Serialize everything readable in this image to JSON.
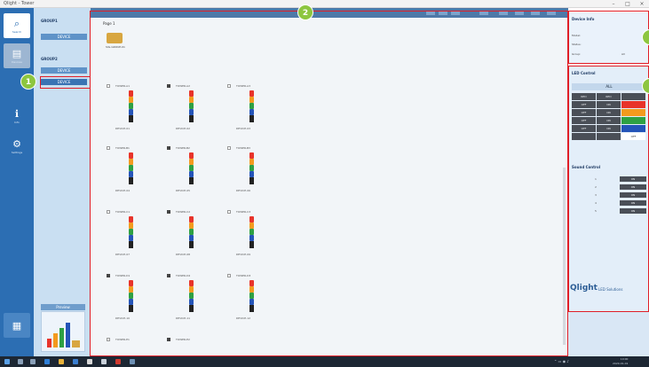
{
  "window": {
    "title": "Qlight - Tower",
    "controls": [
      "–",
      "□",
      "×"
    ]
  },
  "nav": [
    {
      "label": "Search",
      "icon": "magnifier-icon",
      "glyph": "⌕",
      "active": true
    },
    {
      "label": "Devices",
      "icon": "device-icon",
      "glyph": "▤",
      "active": false
    },
    {
      "label": "Info",
      "icon": "info-icon",
      "glyph": "ℹ",
      "active": false
    },
    {
      "label": "Settings",
      "icon": "settings-icon",
      "glyph": "⚙",
      "active": false
    }
  ],
  "tree": {
    "group_a": {
      "head": "GROUP1",
      "item": "DEVICE"
    },
    "group_b": {
      "head": "GROUP2",
      "item_1": "DEVICE",
      "item_2": "DEVICE"
    },
    "thumb_tag": "Preview"
  },
  "main": {
    "page_tab": "Page 1",
    "group_label": "SIG-GROUP-01",
    "towers": [
      {
        "name": "TOWER-A1",
        "cap": "DEVICE-01",
        "checked": false
      },
      {
        "name": "TOWER-A2",
        "cap": "DEVICE-02",
        "checked": true
      },
      {
        "name": "TOWER-A3",
        "cap": "DEVICE-03",
        "checked": false
      },
      {
        "name": "TOWER-B1",
        "cap": "DEVICE-04",
        "checked": false
      },
      {
        "name": "TOWER-B2",
        "cap": "DEVICE-05",
        "checked": true
      },
      {
        "name": "TOWER-B3",
        "cap": "DEVICE-06",
        "checked": false
      },
      {
        "name": "TOWER-C1",
        "cap": "DEVICE-07",
        "checked": false
      },
      {
        "name": "TOWER-C2",
        "cap": "DEVICE-08",
        "checked": true
      },
      {
        "name": "TOWER-C3",
        "cap": "DEVICE-09",
        "checked": false
      },
      {
        "name": "TOWER-D1",
        "cap": "DEVICE-10",
        "checked": true
      },
      {
        "name": "TOWER-D2",
        "cap": "DEVICE-11",
        "checked": true
      },
      {
        "name": "TOWER-D3",
        "cap": "DEVICE-12",
        "checked": false
      }
    ],
    "bottom_towers": [
      {
        "name": "TOWER-E1",
        "checked": false
      },
      {
        "name": "TOWER-E2",
        "checked": true
      }
    ]
  },
  "status_panel": {
    "title": "Device Info",
    "rows": [
      "Model:",
      "Status:",
      "Group:"
    ],
    "dropdown": "All"
  },
  "control_panel": {
    "title": "LED Control",
    "all_label": "ALL",
    "cells": [
      {
        "label": "RED",
        "color": "#4a4f57"
      },
      {
        "label": "RED",
        "color": "#4a4f57"
      },
      {
        "label": "",
        "color": "#4a4f57"
      },
      {
        "label": "OFF",
        "color": "#4a4f57"
      },
      {
        "label": "ON",
        "color": "#4a4f57"
      },
      {
        "label": "",
        "color": "#e8332a"
      },
      {
        "label": "OFF",
        "color": "#4a4f57"
      },
      {
        "label": "ON",
        "color": "#4a4f57"
      },
      {
        "label": "",
        "color": "#f39a1e"
      },
      {
        "label": "OFF",
        "color": "#4a4f57"
      },
      {
        "label": "ON",
        "color": "#4a4f57"
      },
      {
        "label": "",
        "color": "#2ea043"
      },
      {
        "label": "OFF",
        "color": "#4a4f57"
      },
      {
        "label": "ON",
        "color": "#4a4f57"
      },
      {
        "label": "",
        "color": "#2454b8"
      },
      {
        "label": "",
        "color": "#4a4f57"
      },
      {
        "label": "",
        "color": "#4a4f57"
      },
      {
        "label": "OFF",
        "color": "#ffffff"
      }
    ],
    "sound_title": "Sound Control",
    "sound_rows": [
      {
        "label": "1",
        "button": "ON"
      },
      {
        "label": "2",
        "button": "ON"
      },
      {
        "label": "3",
        "button": "ON"
      },
      {
        "label": "4",
        "button": "ON"
      },
      {
        "label": "5",
        "button": "ON"
      }
    ],
    "logo": "Qlight",
    "logo_sub": "LED Solutions"
  },
  "badges": [
    "1",
    "2"
  ],
  "taskbar": {
    "tray": "⌃ ▭ ◉ ♪",
    "time": "10:00",
    "date": "2020-01-01"
  }
}
